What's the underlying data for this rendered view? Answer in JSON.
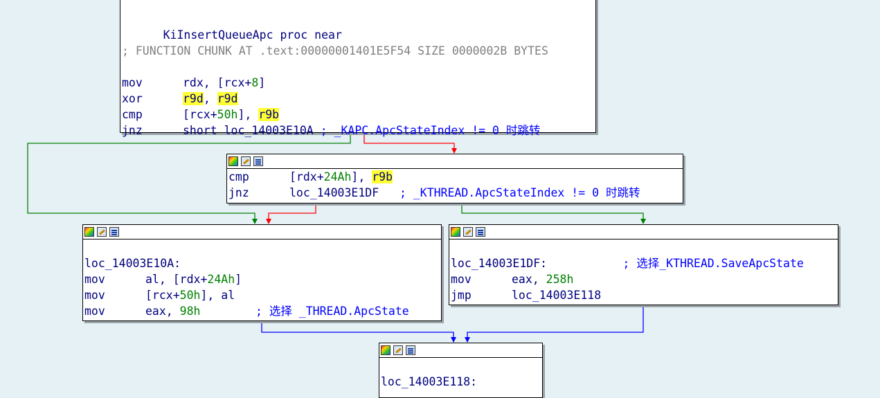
{
  "nodes": {
    "top": {
      "proc_name": "KiInsertQueueApc",
      "proc_kw": "proc near",
      "chunk_comment": "; FUNCTION CHUNK AT .text:00000001401E5F54 SIZE 0000002B BYTES",
      "rows": [
        {
          "mnem": "mov",
          "a1": "rdx, [rcx+",
          "n1": "8",
          "a2": "]"
        },
        {
          "mnem": "xor",
          "r1": "r9d",
          "sep": ", ",
          "r2": "r9d"
        },
        {
          "mnem": "cmp",
          "a1": "[rcx+",
          "n1": "50h",
          "a2": "], ",
          "r1": "r9b"
        },
        {
          "mnem": "jnz",
          "a1": "short loc_14003E10A ",
          "comment": "; _KAPC.ApcStateIndex != 0 时跳转"
        }
      ]
    },
    "mid": {
      "rows": [
        {
          "mnem": "cmp",
          "a1": "[rdx+",
          "n1": "24Ah",
          "a2": "], ",
          "r1": "r9b"
        },
        {
          "mnem": "jnz",
          "a1": "loc_14003E1DF   ",
          "comment": "; _KTHREAD.ApcStateIndex != 0 时跳转"
        }
      ]
    },
    "left": {
      "label": "loc_14003E10A:",
      "rows": [
        {
          "mnem": "mov",
          "a1": "al, [rdx+",
          "n1": "24Ah",
          "a2": "]"
        },
        {
          "mnem": "mov",
          "a1": "[rcx+",
          "n1": "50h",
          "a2": "], al"
        },
        {
          "mnem": "mov",
          "a1": "eax, ",
          "n1": "98h",
          "a2": "        ",
          "comment": "; 选择 _THREAD.ApcState"
        }
      ]
    },
    "right": {
      "label": "loc_14003E1DF:",
      "label_comment": "; 选择_KTHREAD.SaveApcState",
      "rows": [
        {
          "mnem": "mov",
          "a1": "eax, ",
          "n1": "258h"
        },
        {
          "mnem": "jmp",
          "a1": "loc_14003E118"
        }
      ]
    },
    "bottom": {
      "label": "loc_14003E118:"
    }
  },
  "colors": {
    "background": "#e6f1f6",
    "edge_true": "#ff0000",
    "edge_false": "#008000",
    "edge_jump": "#0000ff",
    "highlight": "#ffff33"
  }
}
